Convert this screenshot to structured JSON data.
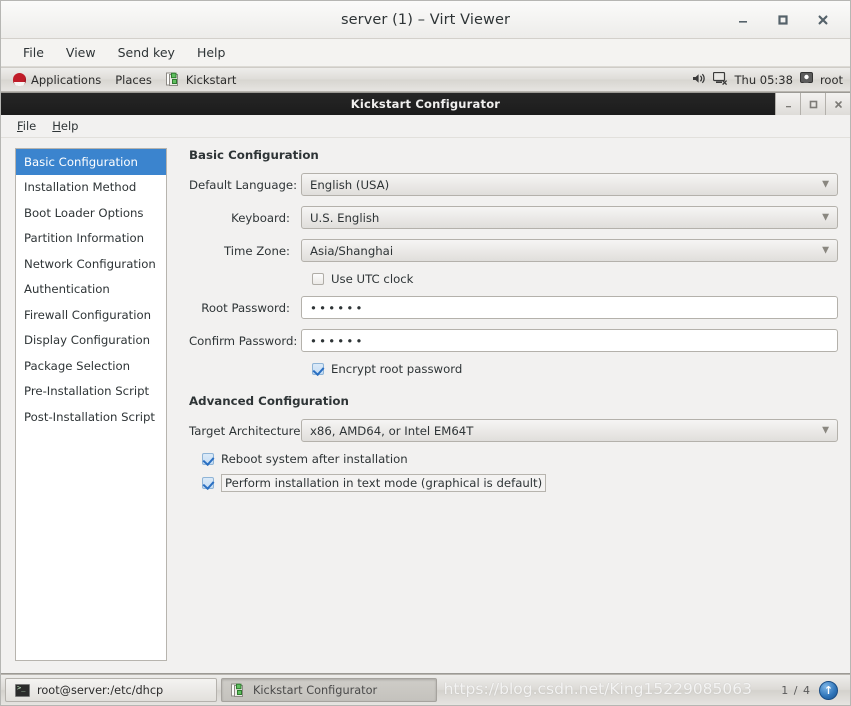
{
  "viewer": {
    "title": "server (1) – Virt Viewer",
    "window_buttons": [
      {
        "name": "minimize",
        "glyph": "–"
      },
      {
        "name": "maximize",
        "glyph": "□"
      },
      {
        "name": "close",
        "glyph": "✕"
      }
    ],
    "menus": [
      "File",
      "View",
      "Send key",
      "Help"
    ]
  },
  "panel": {
    "applications": "Applications",
    "places": "Places",
    "app_window": "Kickstart",
    "clock": "Thu 05:38",
    "user": "root",
    "icons": {
      "redhat": "redhat-icon",
      "kickstart": "kickstart-icon",
      "volume": "volume-icon",
      "network": "network-icon",
      "user": "user-icon"
    }
  },
  "ks_window": {
    "title": "Kickstart Configurator",
    "window_buttons": [
      {
        "name": "minimize",
        "glyph": "–"
      },
      {
        "name": "maximize",
        "glyph": "❐"
      },
      {
        "name": "close",
        "glyph": "✕"
      }
    ],
    "menus": [
      {
        "mnemonic": "F",
        "rest": "ile"
      },
      {
        "mnemonic": "H",
        "rest": "elp"
      }
    ],
    "sidebar": {
      "selected_index": 0,
      "items": [
        "Basic Configuration",
        "Installation Method",
        "Boot Loader Options",
        "Partition Information",
        "Network Configuration",
        "Authentication",
        "Firewall Configuration",
        "Display Configuration",
        "Package Selection",
        "Pre-Installation Script",
        "Post-Installation Script"
      ]
    },
    "basic": {
      "heading": "Basic Configuration",
      "language_label": "Default Language:",
      "language_value": "English (USA)",
      "keyboard_label": "Keyboard:",
      "keyboard_value": "U.S. English",
      "timezone_label": "Time Zone:",
      "timezone_value": "Asia/Shanghai",
      "utc_label": "Use UTC clock",
      "utc_checked": false,
      "root_password_label": "Root Password:",
      "root_password_value": "••••••",
      "confirm_password_label": "Confirm Password:",
      "confirm_password_value": "••••••",
      "encrypt_label": "Encrypt root password",
      "encrypt_checked": true
    },
    "advanced": {
      "heading": "Advanced Configuration",
      "target_arch_label": "Target Architecture:",
      "target_arch_value": "x86, AMD64, or Intel EM64T",
      "reboot_label": "Reboot system after installation",
      "reboot_checked": true,
      "textmode_label": "Perform installation in text mode (graphical is default)",
      "textmode_checked": true
    }
  },
  "taskbar": {
    "terminal_task": "root@server:/etc/dhcp",
    "kickstart_task": "Kickstart Configurator",
    "pager": "1 / 4",
    "update_icon": "software-update-icon"
  },
  "watermark": "https://blog.csdn.net/King15229085063",
  "colors": {
    "selection_blue": "#3b84ce",
    "titlebar_dark": "#1c1c1c",
    "panel_grey": "#dedcd8",
    "check_blue": "#2a6fc2"
  }
}
